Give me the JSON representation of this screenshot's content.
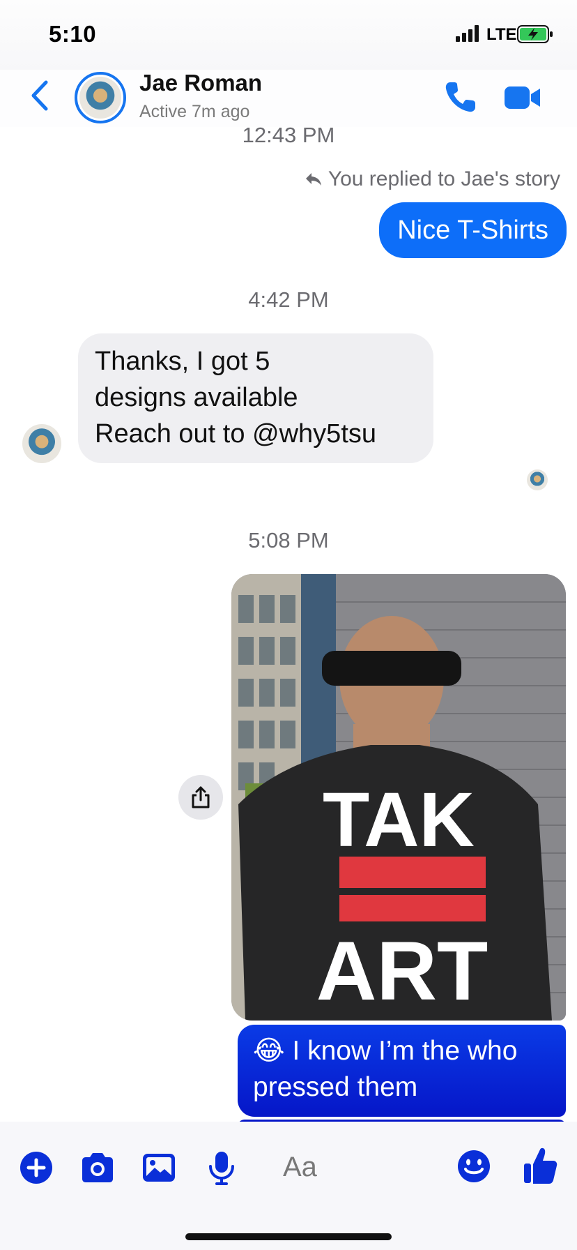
{
  "status_bar": {
    "time": "5:10",
    "network": "LTE"
  },
  "header": {
    "contact_name": "Jae Roman",
    "contact_status": "Active 7m ago"
  },
  "chat": {
    "messages": [
      {
        "timestamp": "12:43 PM"
      },
      {
        "reply_note": "You replied to Jae's story",
        "text": "Nice T-Shirts",
        "direction": "outgoing"
      },
      {
        "timestamp": "4:42 PM"
      },
      {
        "text_lines": [
          "Thanks, I got 5",
          "designs available",
          "Reach out to  @why5tsu"
        ],
        "direction": "incoming"
      },
      {
        "timestamp": "5:08 PM"
      },
      {
        "type": "photo",
        "shirt_text_top": "TAK",
        "shirt_text_bottom": "ART",
        "direction": "outgoing"
      },
      {
        "emoji": "😂",
        "text_line1": " I know I’m the who",
        "text_line2": "pressed them",
        "direction": "outgoing"
      }
    ]
  },
  "composer": {
    "placeholder": "Aa"
  },
  "colors": {
    "accent": "#0d6ef9",
    "composer_icons": "#0a2fd8",
    "header_icons": "#1675f0",
    "incoming_bubble": "#efeff2"
  },
  "icons": [
    "back-arrow-icon",
    "phone-icon",
    "video-camera-icon",
    "reply-arrow-icon",
    "share-icon",
    "plus-icon",
    "camera-icon",
    "photo-icon",
    "microphone-icon",
    "emoji-icon",
    "thumbs-up-icon",
    "signal-icon",
    "battery-icon"
  ]
}
